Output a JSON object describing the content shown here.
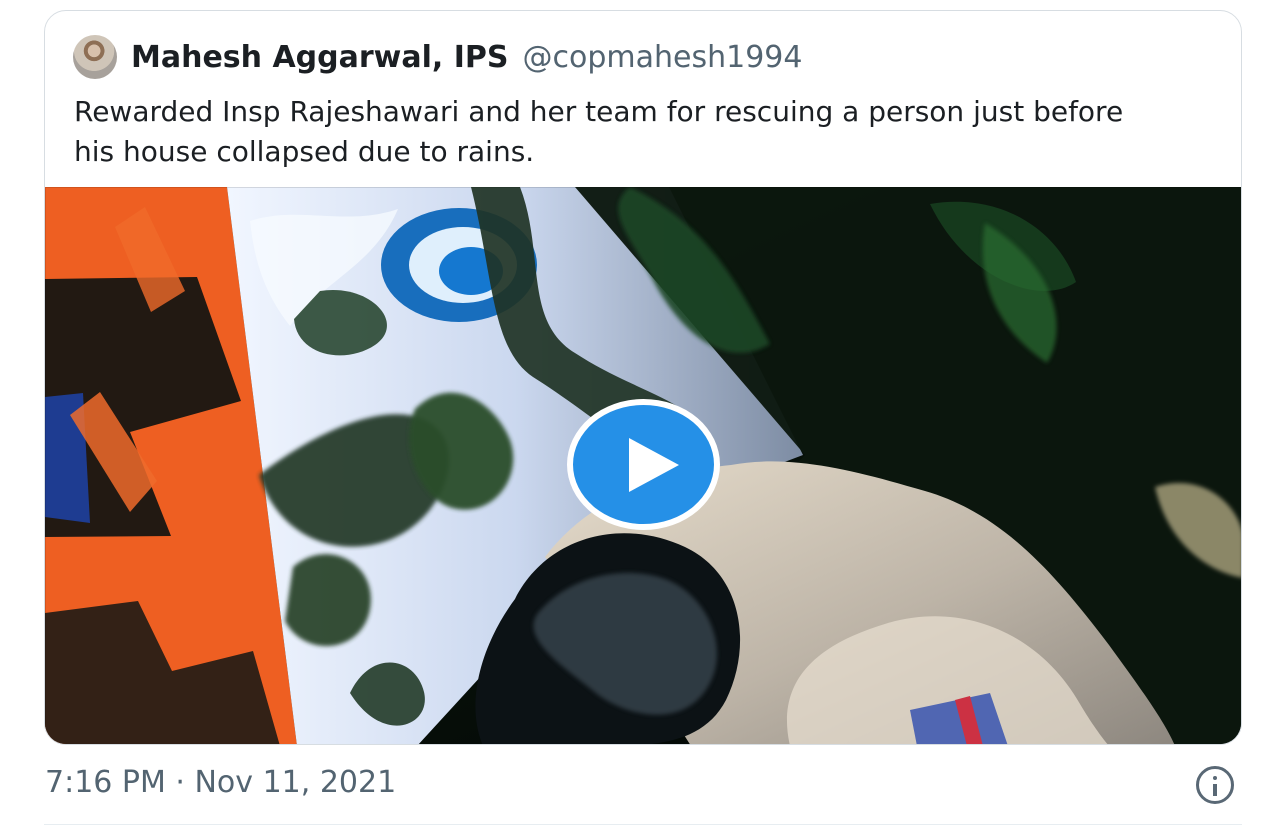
{
  "tweet": {
    "author_name": "Mahesh Aggarwal, IPS",
    "author_handle": "@copmahesh1994",
    "text": "Rewarded Insp Rajeshawari and her team for rescuing a person just before his house collapsed due to rains.",
    "timestamp": "7:16 PM · Nov 11, 2021"
  },
  "media": {
    "type": "video",
    "play_icon": "play-icon",
    "accent_color": "#2590e7"
  },
  "icons": {
    "info": "info-icon"
  }
}
